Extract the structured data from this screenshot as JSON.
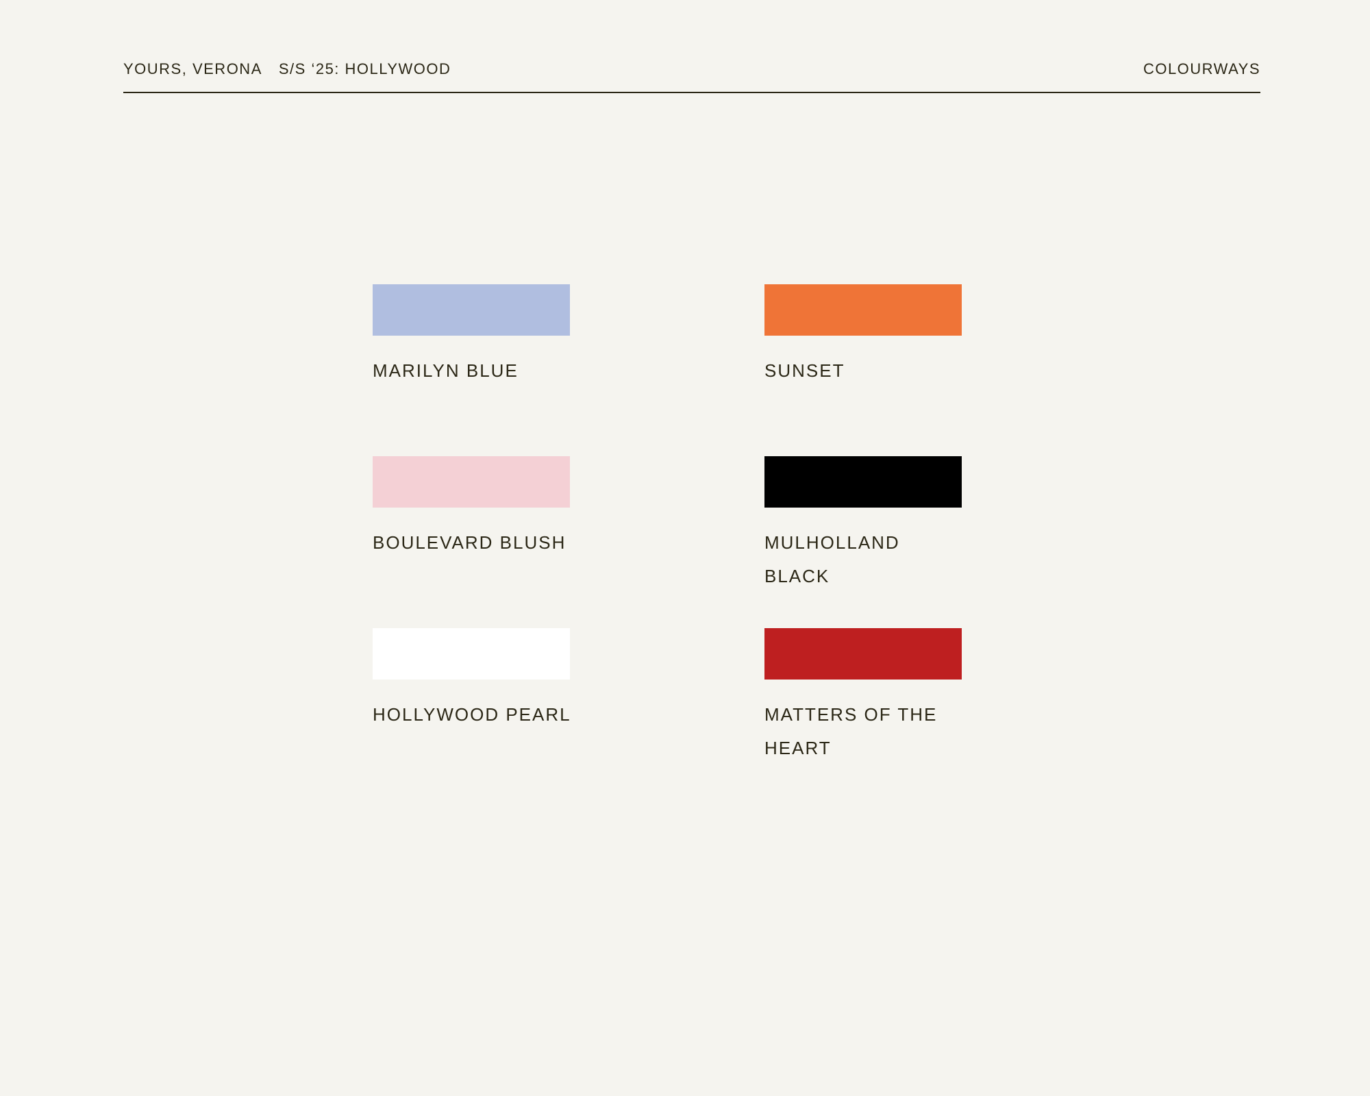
{
  "header": {
    "brand": "YOURS, VERONA",
    "collection": "S/S ‘25: HOLLYWOOD",
    "section": "COLOURWAYS"
  },
  "colourways": [
    {
      "name": "MARILYN BLUE",
      "color": "#b0bee0"
    },
    {
      "name": "SUNSET",
      "color": "#ef7437"
    },
    {
      "name": "BOULEVARD BLUSH",
      "color": "#f4d0d5"
    },
    {
      "name": "MULHOLLAND BLACK",
      "color": "#000000"
    },
    {
      "name": "HOLLYWOOD PEARL",
      "color": "#ffffff"
    },
    {
      "name": "MATTERS OF THE HEART",
      "color": "#be1f20"
    }
  ]
}
